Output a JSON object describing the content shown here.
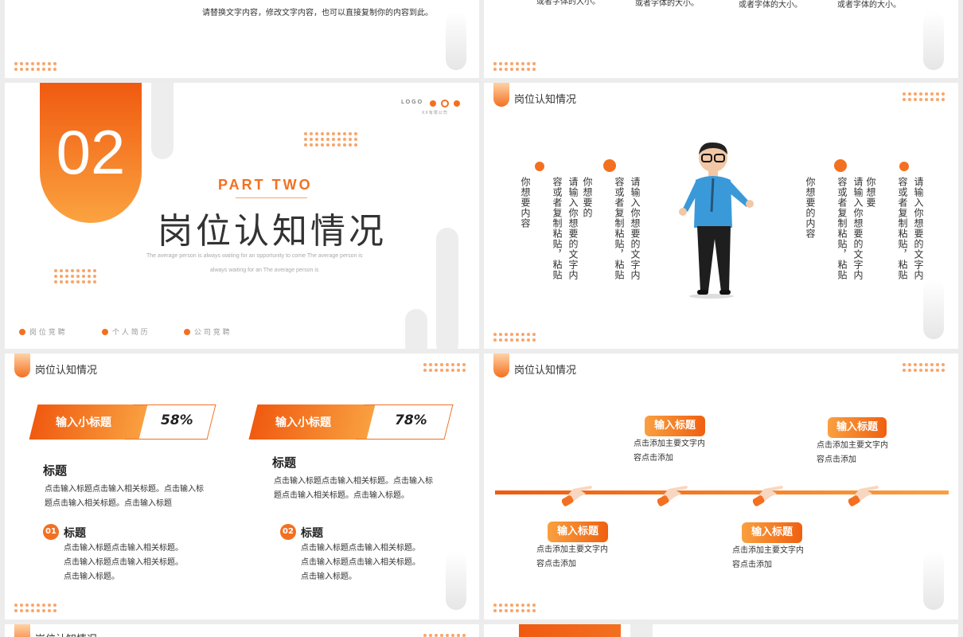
{
  "slide_top_left": {
    "text": "请替换文字内容，修改文字内容，也可以直接复制你的内容到此。"
  },
  "slide_top_right": {
    "items": [
      "或者字体的大小。",
      "或者字体的大小。",
      "或者字体的大小。",
      "或者字体的大小。"
    ]
  },
  "cover": {
    "number": "02",
    "part": "PART TWO",
    "title": "岗位认知情况",
    "subtitle_line1": "The average person is always waiting for an opportunity to come The average person is",
    "subtitle_line2": "always waiting for an The average person is",
    "logo": "LOGO",
    "company": "XX有限公司",
    "nav": [
      "岗 位 竞 聘",
      "个 人 简 历",
      "公 司 竞 聘"
    ]
  },
  "header_title": "岗位认知情况",
  "person_slide": {
    "columns": [
      {
        "main": "请输入你想要的文字内容或者复制粘贴，粘贴",
        "second": "你想要内容"
      },
      {
        "main": "请输入你想要的文字内容或者复制粘贴，粘贴",
        "second": "你想要的"
      },
      {
        "main": "请输入你想要的文字内容或者复制粘贴，粘贴",
        "second": "你想要的内容"
      },
      {
        "main": "请输入你想要的文字内容或者复制粘贴，粘贴",
        "second": "你想要"
      }
    ]
  },
  "stats_slide": {
    "bars": [
      {
        "label": "输入小标题",
        "value": "58%"
      },
      {
        "label": "输入小标题",
        "value": "78%"
      }
    ],
    "blocks": [
      {
        "title": "标题",
        "text": [
          "点击输入标题点击输入相关标题。点击输入标",
          "题点击输入相关标题。点击输入标题"
        ]
      },
      {
        "title": "标题",
        "text": [
          "点击输入标题点击输入相关标题。点击输入标",
          "题点击输入相关标题。点击输入标题。"
        ]
      }
    ],
    "numbered": [
      {
        "num": "01",
        "title": "标题",
        "lines": [
          "点击输入标题点击输入相关标题。",
          "点击输入标题点击输入相关标题。",
          "点击输入标题。"
        ]
      },
      {
        "num": "02",
        "title": "标题",
        "lines": [
          "点击输入标题点击输入相关标题。",
          "点击输入标题点击输入相关标题。",
          "点击输入标题。"
        ]
      }
    ]
  },
  "timeline_slide": {
    "top": [
      {
        "label": "输入标题",
        "lines": [
          "点击添加主要文字内",
          "容点击添加"
        ]
      },
      {
        "label": "输入标题",
        "lines": [
          "点击添加主要文字内",
          "容点击添加"
        ]
      }
    ],
    "bottom": [
      {
        "label": "输入标题",
        "lines": [
          "点击添加主要文字内",
          "容点击添加"
        ]
      },
      {
        "label": "输入标题",
        "lines": [
          "点击添加主要文字内",
          "容点击添加"
        ]
      }
    ]
  },
  "colors": {
    "accent": "#f37021",
    "accent_light": "#f9a040"
  }
}
